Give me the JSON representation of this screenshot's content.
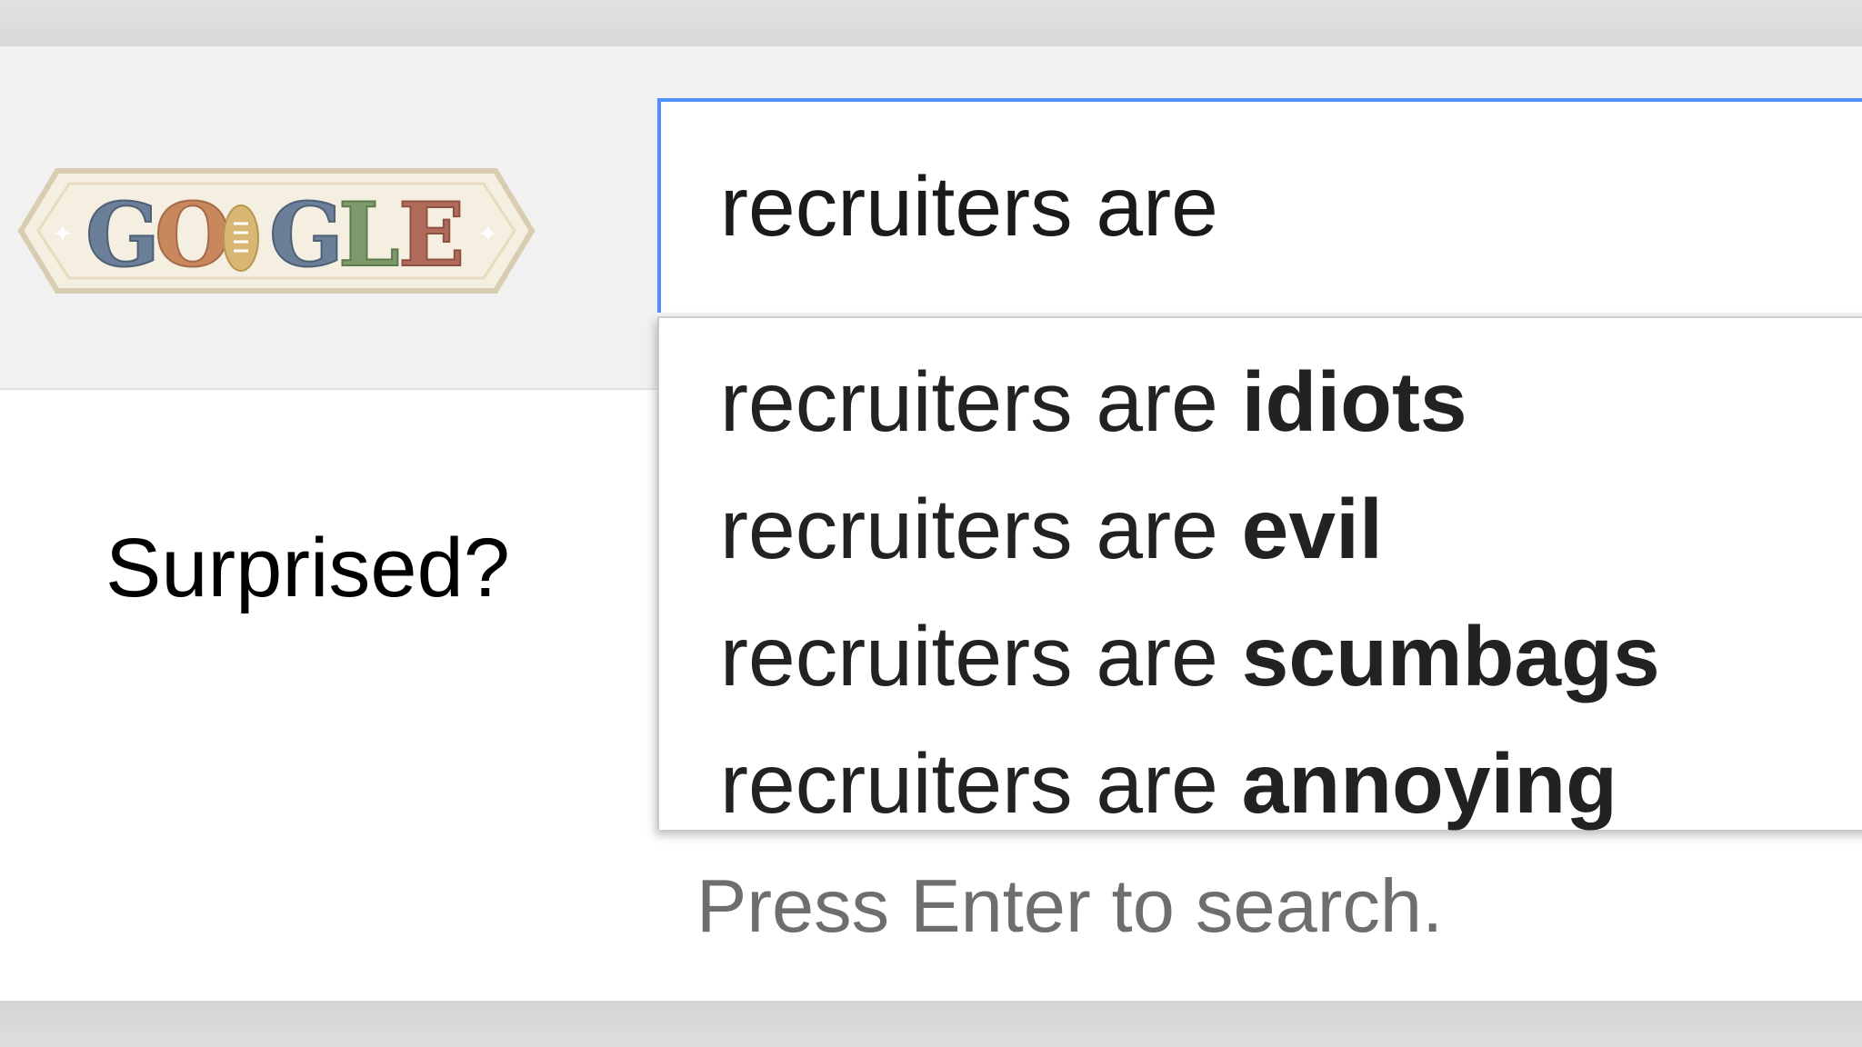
{
  "logo": {
    "text": "GO GLE",
    "letters": [
      "G",
      "O",
      "G",
      "L",
      "E"
    ],
    "letter_colors": [
      "#6b7f99",
      "#c9875e",
      "#6b7f99",
      "#7d9a6a",
      "#b06a5a"
    ],
    "ball_color": "#d8b774",
    "badge_fill": "#f5efe1",
    "badge_stroke": "#d9ccb0"
  },
  "search": {
    "query": "recruiters are",
    "border_color": "#4d90fe"
  },
  "suggestions": [
    {
      "prefix": "recruiters are",
      "completion": "idiots"
    },
    {
      "prefix": "recruiters are",
      "completion": "evil"
    },
    {
      "prefix": "recruiters are",
      "completion": "scumbags"
    },
    {
      "prefix": "recruiters are",
      "completion": "annoying"
    }
  ],
  "hint": "Press Enter to search.",
  "caption": "Surprised?"
}
